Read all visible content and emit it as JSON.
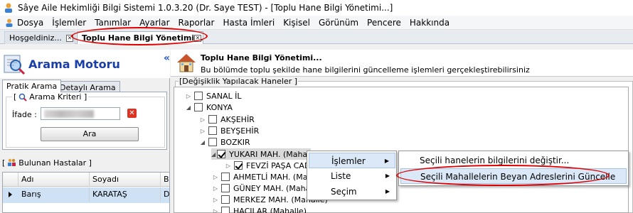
{
  "window": {
    "title": "Sâye Aile Hekimliği Bilgi Sistemi 1.0.3.20 (Dr. Saye TEST) - [Toplu Hane Bilgi Yönetimi...]"
  },
  "menu": [
    "Dosya",
    "İşlemler",
    "Tanımlar",
    "Ayarlar",
    "Raporlar",
    "Hasta İmleri",
    "Kişisel",
    "Görünüm",
    "Pencere",
    "Hakkında"
  ],
  "tabs": [
    {
      "label": "Hoşgeldiniz..."
    },
    {
      "label": "Toplu Hane Bilgi Yönetimi..."
    }
  ],
  "left": {
    "title": "Arama Motoru",
    "tabs": [
      "Pratik Arama",
      "Detaylı Arama"
    ],
    "criteria_group": "Arama Kriteri",
    "ifade_label": "İfade :",
    "search_button": "Ara",
    "found_group": "Bulunan Hastalar",
    "columns": [
      "Adı",
      "Soyadı",
      "B"
    ],
    "rows": [
      {
        "ad": "Barış",
        "soyad": "KARATAŞ",
        "b": "D"
      }
    ]
  },
  "right": {
    "title": "Toplu Hane Bilgi Yönetimi...",
    "subtitle": "Bu bölümde toplu şekilde hane bilgilerini güncelleme işlemleri gerçekleştirebilirsiniz",
    "group_label": "Değişiklik Yapılacak Haneler",
    "tree": [
      {
        "label": "SANAL İL",
        "checked": false
      },
      {
        "label": "KONYA",
        "checked": false
      },
      {
        "label": "AKŞEHİR",
        "checked": false
      },
      {
        "label": "BEYŞEHİR",
        "checked": false
      },
      {
        "label": "BOZKIR",
        "checked": false
      },
      {
        "label": "YUKARI MAH. (Mahalle)",
        "checked": true
      },
      {
        "label": "FEVZİ PAŞA CAD.",
        "checked": true
      },
      {
        "label": "AHMETLİ MAH. (Mahalle)",
        "checked": false
      },
      {
        "label": "GÜNEY MAH. (Mahalle)",
        "checked": false
      },
      {
        "label": "MERKEZ MAH. (Mahalle)",
        "checked": false
      },
      {
        "label": "HACILAR (Mahalle)",
        "checked": false
      }
    ]
  },
  "context_menu": {
    "items": [
      "İşlemler",
      "Liste",
      "Seçim"
    ]
  },
  "submenu": {
    "items": [
      "Seçili hanelerin bilgilerini değiştir...",
      "Seçili Mahallelerin Beyan Adreslerini Güncelle"
    ]
  }
}
